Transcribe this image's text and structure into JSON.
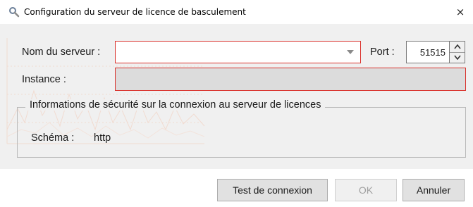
{
  "window": {
    "title": "Configuration du serveur de licence de basculement",
    "close_glyph": "×"
  },
  "form": {
    "server_name_label": "Nom du serveur :",
    "server_name_value": "",
    "port_label": "Port :",
    "port_value": "51515",
    "instance_label": "Instance :",
    "instance_value": ""
  },
  "security_group": {
    "title": "Informations de sécurité sur la connexion au serveur de licences",
    "schema_label": "Schéma :",
    "schema_value": "http"
  },
  "buttons": {
    "test_connection": "Test de connexion",
    "ok": "OK",
    "cancel": "Annuler"
  },
  "colors": {
    "error_border": "#d9312b",
    "dialog_background": "#f0f0f0",
    "disabled_field": "#dcdcdc"
  },
  "icons": {
    "title": "search-key-icon",
    "close": "close-icon",
    "dropdown": "chevron-down-icon",
    "spin_up": "spin-up-icon",
    "spin_down": "spin-down-icon"
  }
}
